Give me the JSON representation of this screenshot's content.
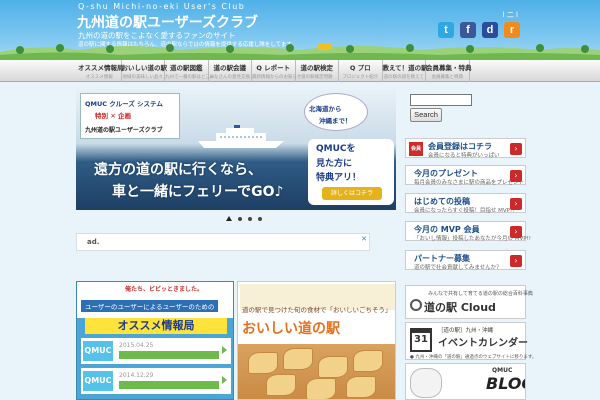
{
  "header": {
    "logo_en": "Q-shu Michi-no-eki User's Club",
    "title": "九州道の駅ユーザーズクラブ",
    "tagline": "九州の道の駅をこよなく愛するファンのサイト",
    "description": "道の駅に関する情報はもちろん、道の駅ならではの情報を提供する応援し隊をしてます。",
    "links": "l 二 l"
  },
  "social": {
    "twitter": "t",
    "facebook": "f",
    "delicious": "d",
    "rss": "r"
  },
  "nav": [
    {
      "label": "オススメ情報局",
      "sub": "オススメ情報"
    },
    {
      "label": "おいしい道の駅",
      "sub": "地域の美味しい品々"
    },
    {
      "label": "道の駅図鑑",
      "sub": "九州で一番の駅はどこに"
    },
    {
      "label": "道の駅会議",
      "sub": "みなさんの意見交換"
    },
    {
      "label": "Q レポート",
      "sub": "最新情報からのお知らせ"
    },
    {
      "label": "道の駅検定",
      "sub": "道の駅検定問題"
    },
    {
      "label": "Q プロ",
      "sub": "プロジェクト紹介"
    },
    {
      "label": "教えて！道の駅",
      "sub": "道の駅の謎を教えて"
    },
    {
      "label": "会員募集・特典",
      "sub": "会員募集と特典"
    }
  ],
  "banner": {
    "logo_top": "QMUC クルーズ システム",
    "logo_mid": "特別 ✕ 企画",
    "logo_bot": "九州道の駅ユーザーズクラブ",
    "bubble_1": "北海道から",
    "bubble_2": "沖縄まで！",
    "qmuc_1": "QMUCを",
    "qmuc_2": "見た方に",
    "qmuc_3": "特典アリ！",
    "qmuc_btn": "詳しくはコチラ",
    "headline_1": "遠方の道の駅に行くなら、",
    "headline_2": "車と一緒にフェリーでGO♪"
  },
  "ad": {
    "label": "ad.",
    "close": "✕"
  },
  "card_left": {
    "tag": "俺たち、ビビッときました。",
    "sub": "ユーザーのユーザーによるユーザーのための",
    "title": "オススメ情報局",
    "items": [
      {
        "thumb": "QMUC",
        "date": "2015.04.25"
      },
      {
        "thumb": "QMUC",
        "date": "2014.12.29"
      }
    ]
  },
  "card_right": {
    "top_text": "道の駅で見つけた旬の食材で「おいしいごちそう」",
    "title": "おいしい道の駅"
  },
  "sidebar": {
    "search_button": "Search",
    "boxes": [
      {
        "icon": "会員",
        "title": "会員登録はコチラ",
        "sub": "会員になると特典がいっぱい"
      },
      {
        "icon": "",
        "title": "今月のプレゼント",
        "sub": "毎月会員のみなさまに駅の商品をプレゼント"
      },
      {
        "icon": "",
        "title": "はじめての投稿",
        "sub": "会員になったらすぐ投稿！目指せ MVP!!"
      },
      {
        "icon": "",
        "title": "今月の MVP 会員",
        "sub": "「おいし情報」投稿したあなたが今月の MVP!!"
      },
      {
        "icon": "",
        "title": "パートナー募集",
        "sub": "道の駅で社会貢献してみませんか？"
      }
    ],
    "cloud_sub": "みんなで共有して育てる道の駅の総合百科事典",
    "cloud_title": "道の駅 Cloud",
    "cal_day": "31",
    "cal_sub": "［道の駅］九州・沖縄",
    "cal_title": "イベントカレンダー",
    "cal_desc": "● 九州・沖縄の「道の駅」通過点のウェブサイトに移ります。",
    "blog_q": "QMUC",
    "blog_b": "BLOG"
  }
}
